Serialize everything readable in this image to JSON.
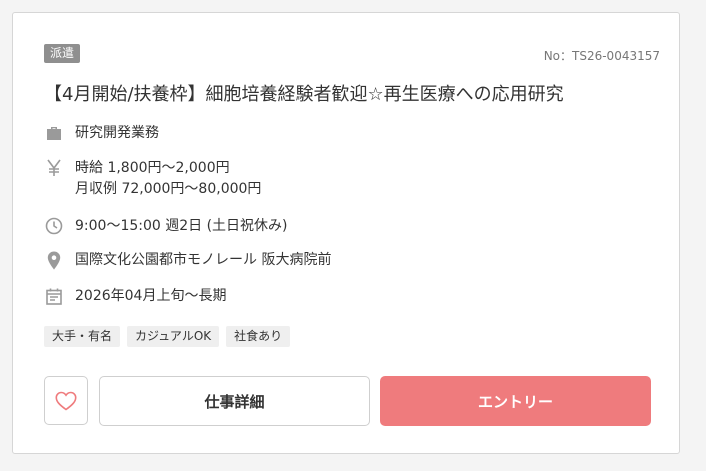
{
  "job": {
    "badge": "派遣",
    "number": "No：TS26-0043157",
    "title": "【4月開始/扶養枠】細胞培養経験者歓迎☆再生医療への応用研究",
    "category": "研究開発業務",
    "wage_hourly": "時給 1,800円〜2,000円",
    "wage_monthly": "月収例 72,000円〜80,000円",
    "hours": "9:00〜15:00 週2日 (土日祝休み)",
    "location": "国際文化公園都市モノレール 阪大病院前",
    "period": "2026年04月上旬〜長期",
    "tags": [
      "大手・有名",
      "カジュアルOK",
      "社食あり"
    ]
  },
  "actions": {
    "favorite_icon": "heart-icon",
    "detail_label": "仕事詳細",
    "entry_label": "エントリー"
  },
  "colors": {
    "accent": "#ef7b7d",
    "badge_bg": "#8f8f8f",
    "icon": "#9a9a9a"
  },
  "icons": [
    "briefcase-icon",
    "yen-icon",
    "clock-icon",
    "map-pin-icon",
    "calendar-icon"
  ]
}
